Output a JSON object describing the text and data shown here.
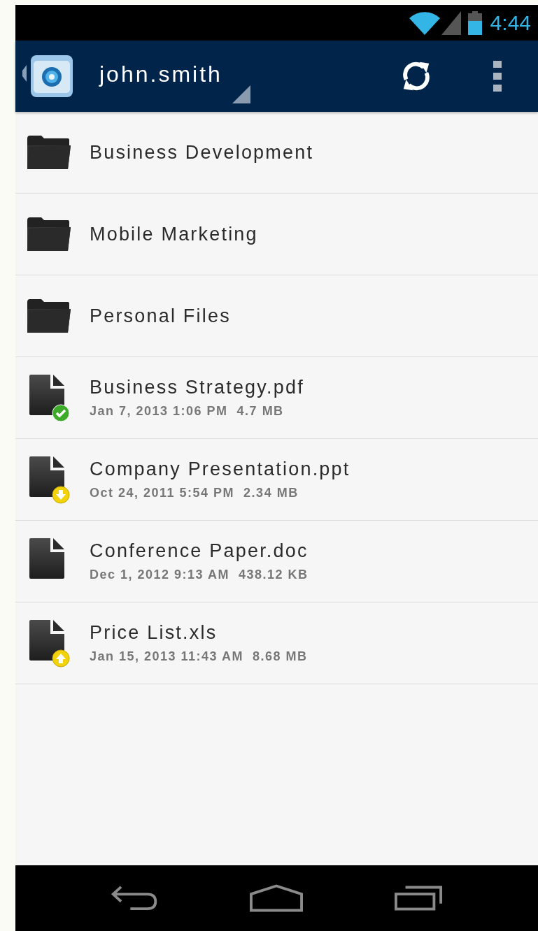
{
  "status_bar": {
    "time": "4:44"
  },
  "action_bar": {
    "account": "john.smith"
  },
  "items": [
    {
      "kind": "folder",
      "name": "Business Development"
    },
    {
      "kind": "folder",
      "name": "Mobile Marketing"
    },
    {
      "kind": "folder",
      "name": "Personal Files"
    },
    {
      "kind": "file",
      "name": "Business Strategy.pdf",
      "meta": "Jan 7, 2013 1:06 PM  4.7 MB",
      "synced": true,
      "downloading": false,
      "uploading": false
    },
    {
      "kind": "file",
      "name": "Company Presentation.ppt",
      "meta": "Oct 24, 2011 5:54 PM  2.34 MB",
      "synced": false,
      "downloading": true,
      "uploading": false
    },
    {
      "kind": "file",
      "name": "Conference Paper.doc",
      "meta": "Dec 1, 2012 9:13 AM  438.12 KB",
      "synced": false,
      "downloading": false,
      "uploading": false
    },
    {
      "kind": "file",
      "name": "Price List.xls",
      "meta": "Jan 15, 2013 11:43 AM  8.68 MB",
      "synced": false,
      "downloading": false,
      "uploading": true
    }
  ]
}
